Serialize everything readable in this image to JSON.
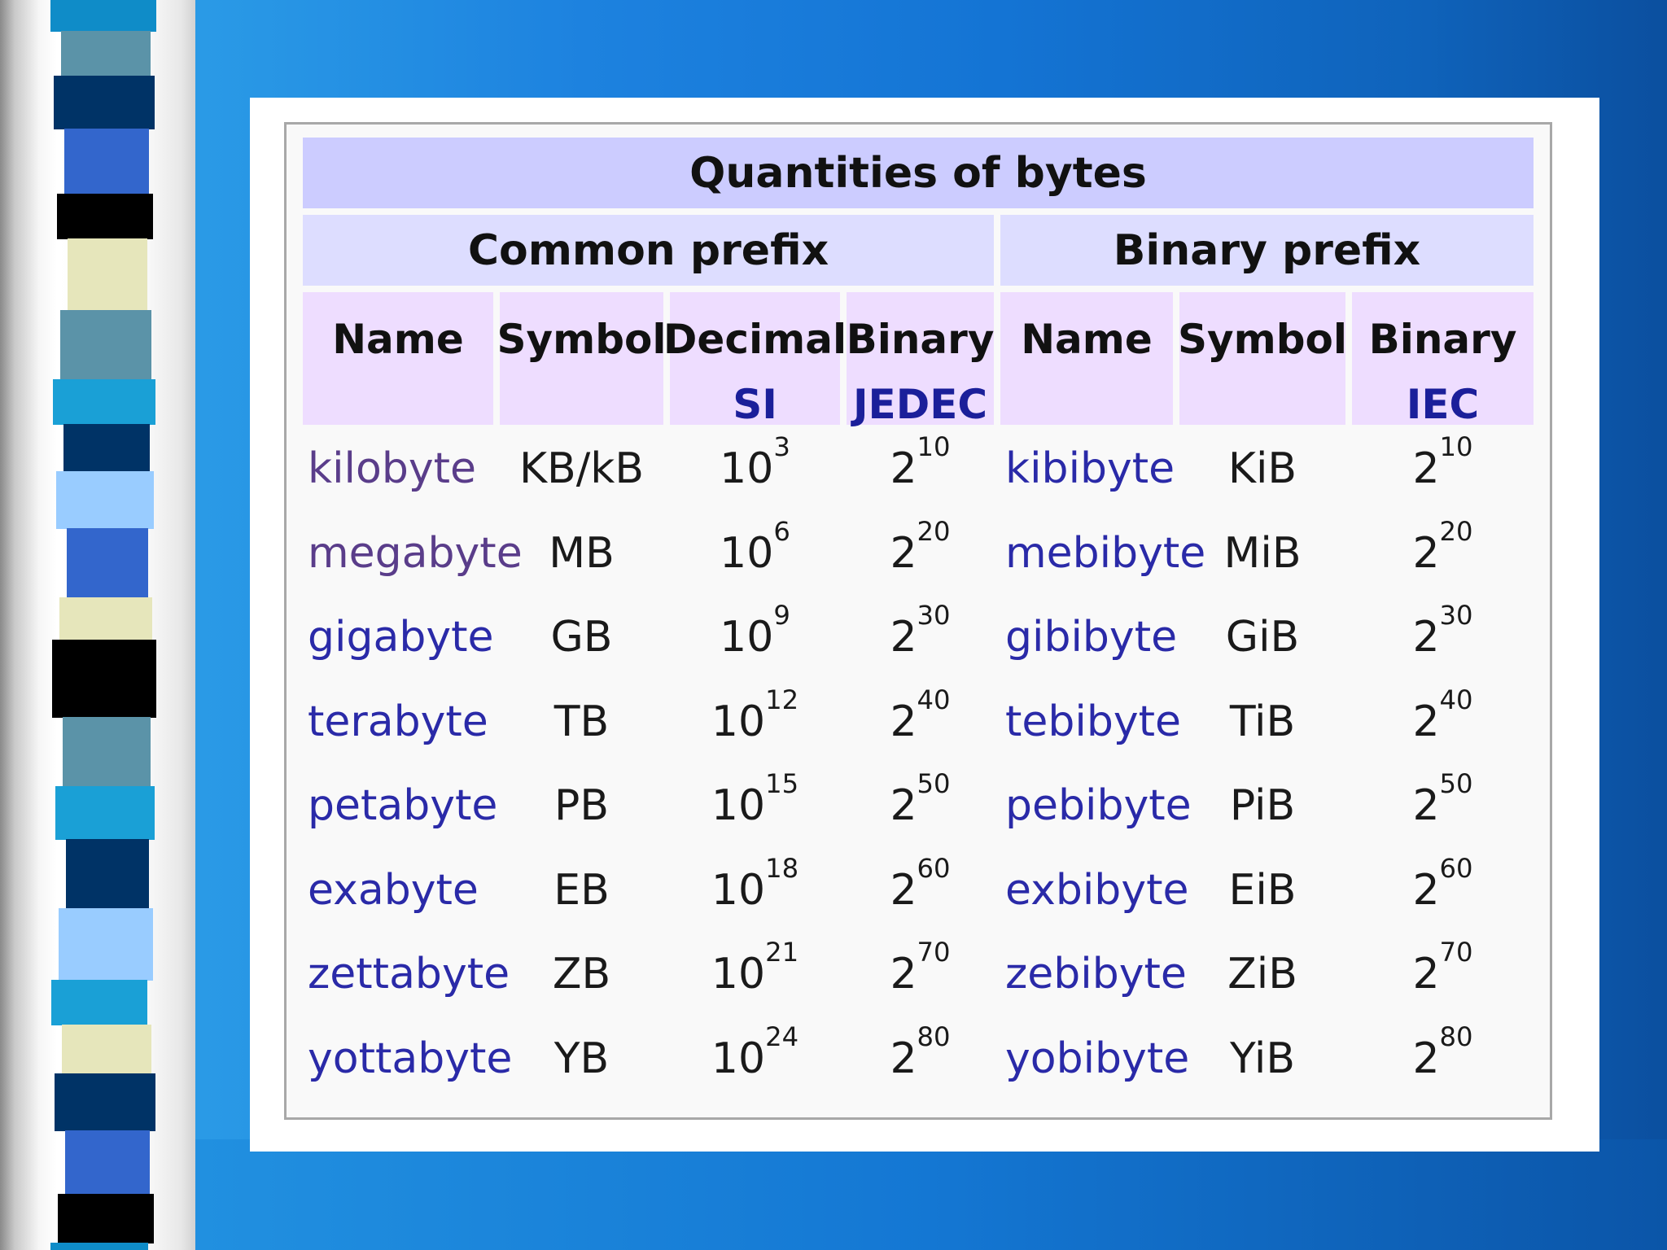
{
  "table": {
    "title": "Quantities of bytes",
    "groups": [
      "Common prefix",
      "Binary prefix"
    ],
    "columns": [
      {
        "label": "Name",
        "standard": ""
      },
      {
        "label": "Symbol",
        "standard": ""
      },
      {
        "label": "Decimal",
        "standard": "SI"
      },
      {
        "label": "Binary",
        "standard": "JEDEC"
      },
      {
        "label": "Name",
        "standard": ""
      },
      {
        "label": "Symbol",
        "standard": ""
      },
      {
        "label": "Binary",
        "standard": "IEC"
      }
    ],
    "rows": [
      {
        "name": "kilobyte",
        "symbol": "KB/kB",
        "decimal_exp": "3",
        "binary_exp": "10",
        "bin_name": "kibibyte",
        "bin_symbol": "KiB",
        "iec_exp": "10"
      },
      {
        "name": "megabyte",
        "symbol": "MB",
        "decimal_exp": "6",
        "binary_exp": "20",
        "bin_name": "mebibyte",
        "bin_symbol": "MiB",
        "iec_exp": "20"
      },
      {
        "name": "gigabyte",
        "symbol": "GB",
        "decimal_exp": "9",
        "binary_exp": "30",
        "bin_name": "gibibyte",
        "bin_symbol": "GiB",
        "iec_exp": "30"
      },
      {
        "name": "terabyte",
        "symbol": "TB",
        "decimal_exp": "12",
        "binary_exp": "40",
        "bin_name": "tebibyte",
        "bin_symbol": "TiB",
        "iec_exp": "40"
      },
      {
        "name": "petabyte",
        "symbol": "PB",
        "decimal_exp": "15",
        "binary_exp": "50",
        "bin_name": "pebibyte",
        "bin_symbol": "PiB",
        "iec_exp": "50"
      },
      {
        "name": "exabyte",
        "symbol": "EB",
        "decimal_exp": "18",
        "binary_exp": "60",
        "bin_name": "exbibyte",
        "bin_symbol": "EiB",
        "iec_exp": "60"
      },
      {
        "name": "zettabyte",
        "symbol": "ZB",
        "decimal_exp": "21",
        "binary_exp": "70",
        "bin_name": "zebibyte",
        "bin_symbol": "ZiB",
        "iec_exp": "70"
      },
      {
        "name": "yottabyte",
        "symbol": "YB",
        "decimal_exp": "24",
        "binary_exp": "80",
        "bin_name": "yobibyte",
        "bin_symbol": "YiB",
        "iec_exp": "80"
      }
    ],
    "decimal_base": "10",
    "binary_base": "2"
  },
  "colors": {
    "title_bg": "#ccccff",
    "group_bg": "#ddddff",
    "column_bg": "#eeddff",
    "link": "#2a2aa8",
    "visited_link": "#5a3d8a"
  }
}
